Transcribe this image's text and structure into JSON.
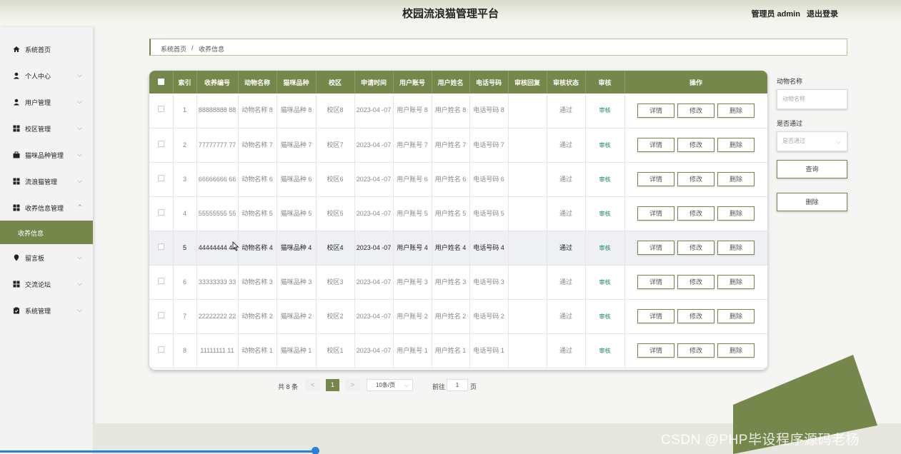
{
  "header": {
    "title": "校园流浪猫管理平台",
    "admin": "管理员 admin",
    "logout": "退出登录"
  },
  "sidebar": {
    "items": [
      {
        "label": "系统首页",
        "icon": "home-icon",
        "has_children": false
      },
      {
        "label": "个人中心",
        "icon": "user-icon",
        "has_children": true
      },
      {
        "label": "用户管理",
        "icon": "user-icon",
        "has_children": true
      },
      {
        "label": "校区管理",
        "icon": "grid-icon",
        "has_children": true
      },
      {
        "label": "猫咪品种管理",
        "icon": "briefcase-icon",
        "has_children": true
      },
      {
        "label": "流浪猫管理",
        "icon": "grid-icon",
        "has_children": true
      },
      {
        "label": "收养信息管理",
        "icon": "grid-icon",
        "has_children": true,
        "expanded": true
      },
      {
        "label": "留言板",
        "icon": "pin-icon",
        "has_children": true
      },
      {
        "label": "交流论坛",
        "icon": "grid-icon",
        "has_children": true
      },
      {
        "label": "系统管理",
        "icon": "clipboard-icon",
        "has_children": true
      }
    ],
    "active_sub": "收养信息"
  },
  "breadcrumb": {
    "home": "系统首页",
    "sep": "/",
    "current": "收养信息"
  },
  "table": {
    "headers": [
      "索引",
      "收养编号",
      "动物名称",
      "猫咪品种",
      "校区",
      "申请时间",
      "用户账号",
      "用户姓名",
      "电话号码",
      "审核回复",
      "审核状态",
      "审核",
      "操作"
    ],
    "rows": [
      {
        "index": "1",
        "code": "88888888 88",
        "animal": "动物名称 8",
        "breed": "猫咪品种 8",
        "campus": "校区8",
        "time": "2023-04 -07",
        "account": "用户账号 8",
        "name": "用户姓名 8",
        "phone": "电话号码 8",
        "reply": "",
        "status": "通过",
        "audit": "审核"
      },
      {
        "index": "2",
        "code": "77777777 77",
        "animal": "动物名称 7",
        "breed": "猫咪品种 7",
        "campus": "校区7",
        "time": "2023-04 -07",
        "account": "用户账号 7",
        "name": "用户姓名 7",
        "phone": "电话号码 7",
        "reply": "",
        "status": "通过",
        "audit": "审核"
      },
      {
        "index": "3",
        "code": "66666666 66",
        "animal": "动物名称 6",
        "breed": "猫咪品种 6",
        "campus": "校区6",
        "time": "2023-04 -07",
        "account": "用户账号 6",
        "name": "用户姓名 6",
        "phone": "电话号码 6",
        "reply": "",
        "status": "通过",
        "audit": "审核"
      },
      {
        "index": "4",
        "code": "55555555 55",
        "animal": "动物名称 5",
        "breed": "猫咪品种 5",
        "campus": "校区5",
        "time": "2023-04 -07",
        "account": "用户账号 5",
        "name": "用户姓名 5",
        "phone": "电话号码 5",
        "reply": "",
        "status": "通过",
        "audit": "审核"
      },
      {
        "index": "5",
        "code": "44444444 44",
        "animal": "动物名称 4",
        "breed": "猫咪品种 4",
        "campus": "校区4",
        "time": "2023-04 -07",
        "account": "用户账号 4",
        "name": "用户姓名 4",
        "phone": "电话号码 4",
        "reply": "",
        "status": "通过",
        "audit": "审核"
      },
      {
        "index": "6",
        "code": "33333333 33",
        "animal": "动物名称 3",
        "breed": "猫咪品种 3",
        "campus": "校区3",
        "time": "2023-04 -07",
        "account": "用户账号 3",
        "name": "用户姓名 3",
        "phone": "电话号码 3",
        "reply": "",
        "status": "通过",
        "audit": "审核"
      },
      {
        "index": "7",
        "code": "22222222 22",
        "animal": "动物名称 2",
        "breed": "猫咪品种 2",
        "campus": "校区2",
        "time": "2023-04 -07",
        "account": "用户账号 2",
        "name": "用户姓名 2",
        "phone": "电话号码 2",
        "reply": "",
        "status": "通过",
        "audit": "审核"
      },
      {
        "index": "8",
        "code": "11111111 11",
        "animal": "动物名称 1",
        "breed": "猫咪品种 1",
        "campus": "校区1",
        "time": "2023-04 -07",
        "account": "用户账号 1",
        "name": "用户姓名 1",
        "phone": "电话号码 1",
        "reply": "",
        "status": "通过",
        "audit": "审核"
      }
    ],
    "actions": {
      "detail": "详情",
      "edit": "修改",
      "delete": "删除"
    }
  },
  "filters": {
    "animal_label": "动物名称",
    "animal_placeholder": "动物名称",
    "pass_label": "是否通过",
    "pass_placeholder": "是否通过",
    "search_button": "查询",
    "delete_button": "删除"
  },
  "pagination": {
    "total": "共 8 条",
    "prev": "<",
    "current_page": "1",
    "next": ">",
    "page_size": "10条/页",
    "goto_label": "前往",
    "goto_value": "1",
    "goto_suffix": "页"
  },
  "watermark": "CSDN @PHP毕设程序源码老杨",
  "colors": {
    "accent": "#76874c",
    "audit_link": "#1a8a5a",
    "progress": "#2d7fd6"
  }
}
